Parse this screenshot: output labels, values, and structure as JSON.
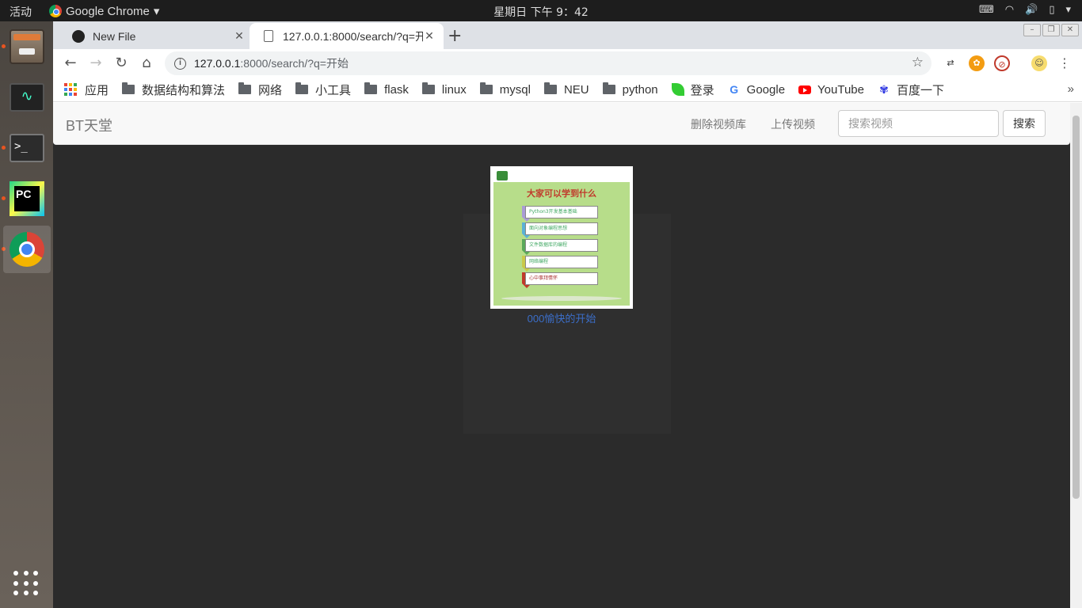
{
  "os": {
    "activities": "活动",
    "app_name": "Google Chrome",
    "clock": "星期日 下午 9：42"
  },
  "browser": {
    "tabs": [
      {
        "title": "New File",
        "favicon": "github-icon"
      },
      {
        "title": "127.0.0.1:8000/search/?q=开始",
        "favicon": "document-icon"
      }
    ],
    "address": {
      "host": "127.0.0.1",
      "rest": ":8000/search/?q=开始"
    },
    "bookmarks": [
      {
        "label": "应用",
        "icon": "apps-icon"
      },
      {
        "label": "数据结构和算法",
        "icon": "folder-icon"
      },
      {
        "label": "网络",
        "icon": "folder-icon"
      },
      {
        "label": "小工具",
        "icon": "folder-icon"
      },
      {
        "label": "flask",
        "icon": "folder-icon"
      },
      {
        "label": "linux",
        "icon": "folder-icon"
      },
      {
        "label": "mysql",
        "icon": "folder-icon"
      },
      {
        "label": "NEU",
        "icon": "folder-icon"
      },
      {
        "label": "python",
        "icon": "folder-icon"
      },
      {
        "label": "登录",
        "icon": "leaf-icon"
      },
      {
        "label": "Google",
        "icon": "google-icon"
      },
      {
        "label": "YouTube",
        "icon": "youtube-icon"
      },
      {
        "label": "百度一下",
        "icon": "baidu-icon"
      }
    ]
  },
  "page": {
    "brand": "BT天堂",
    "nav": {
      "delete_library": "删除视频库",
      "upload": "上传视频"
    },
    "search": {
      "placeholder": "搜索视频",
      "button": "搜索"
    },
    "results": [
      {
        "caption": "000愉快的开始",
        "thumbnail": {
          "heading": "大家可以学到什么",
          "rows": [
            "Python3开发基本基础",
            "面向对象编程思想",
            "文件数据库的编程",
            "网络编程",
            "心中事拜情怀"
          ]
        }
      }
    ]
  }
}
